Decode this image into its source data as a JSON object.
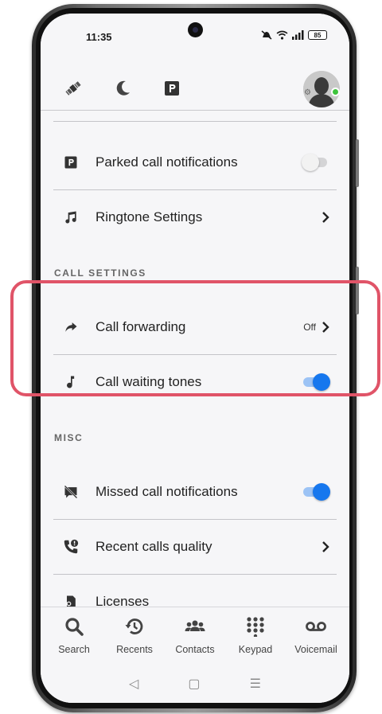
{
  "status_bar": {
    "time": "11:35",
    "battery": "85"
  },
  "colors": {
    "accent": "#1677ee",
    "highlight": "#e05468",
    "presence": "#3ec43c"
  },
  "toolbar": {
    "icons": [
      "satellite-icon",
      "moon-icon",
      "parking-icon"
    ],
    "avatar": "user-avatar"
  },
  "rows": {
    "parked": {
      "label": "Parked call notifications",
      "toggle": false
    },
    "ringtone": {
      "label": "Ringtone Settings"
    },
    "forwarding": {
      "label": "Call forwarding",
      "value": "Off"
    },
    "waiting": {
      "label": "Call waiting tones",
      "toggle": true
    },
    "missed": {
      "label": "Missed call notifications",
      "toggle": true
    },
    "quality": {
      "label": "Recent calls quality"
    },
    "licenses": {
      "label": "Licenses"
    }
  },
  "sections": {
    "call_settings": "CALL SETTINGS",
    "misc": "MISC"
  },
  "bottom_nav": [
    {
      "label": "Search",
      "icon": "search-icon"
    },
    {
      "label": "Recents",
      "icon": "history-icon"
    },
    {
      "label": "Contacts",
      "icon": "contacts-icon"
    },
    {
      "label": "Keypad",
      "icon": "keypad-icon"
    },
    {
      "label": "Voicemail",
      "icon": "voicemail-icon"
    }
  ],
  "system_nav": {
    "back": "◁",
    "home": "▢",
    "recents": "☰"
  }
}
